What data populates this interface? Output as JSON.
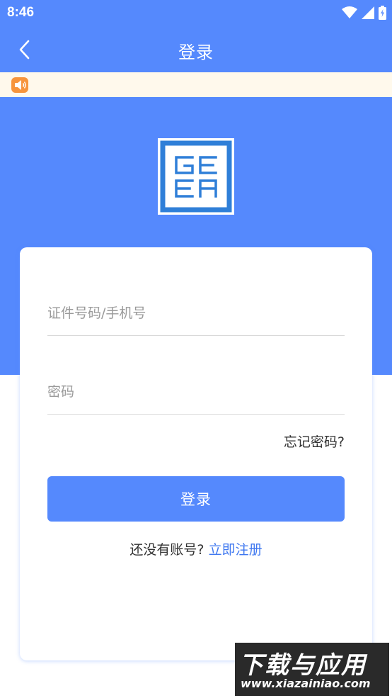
{
  "status_bar": {
    "time": "8:46"
  },
  "header": {
    "title": "登录",
    "back_icon": "chevron-left-icon"
  },
  "notice": {
    "icon": "megaphone-icon",
    "color": "#f7953d",
    "text": ""
  },
  "brand": {
    "logo_text": [
      "GE",
      "EA"
    ]
  },
  "form": {
    "id_placeholder": "证件号码/手机号",
    "id_value": "",
    "password_placeholder": "密码",
    "password_value": "",
    "forgot_label": "忘记密码?",
    "submit_label": "登录",
    "register_prompt": "还没有账号?",
    "register_link": "立即注册"
  },
  "watermark": {
    "title": "下载与应用",
    "url": "www.xiazainiao.com"
  },
  "colors": {
    "primary": "#5589fd",
    "link": "#3f78f0",
    "notice_bg": "#fff9ec"
  }
}
